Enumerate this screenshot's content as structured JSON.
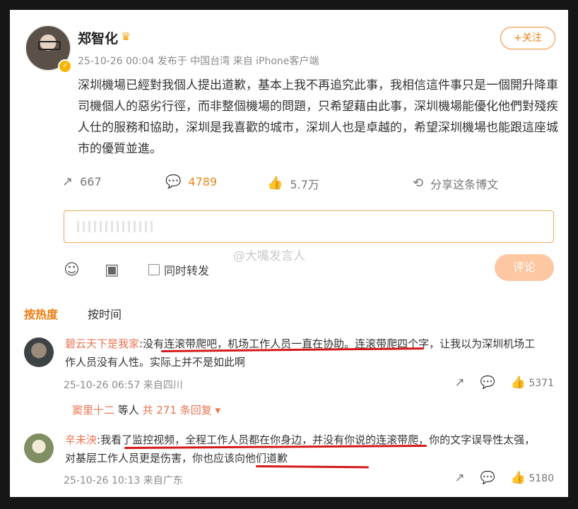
{
  "post": {
    "author": "郑智化",
    "crown_icon": "crown-icon",
    "meta": "25-10-26 00:04 发布于 中国台湾 来自 iPhone客户端",
    "follow_label": "+关注",
    "content": "深圳機場已經對我個人提出道歉，基本上我不再追究此事，我相信這件事只是一個開升降車司機個人的惡劣行徑，而非整個機場的問題，只希望藉由此事，深圳機場能優化他們對殘疾人仕的服務和協助，深圳是我喜歡的城市，深圳人也是卓越的，希望深圳機場也能跟這座城市的優質並進。",
    "repost_count": "667",
    "comment_count": "4789",
    "like_count": "5.7万",
    "share_label": "分享这条博文"
  },
  "composer": {
    "watermark": "@大嘴发言人",
    "checkbox_label": "同时转发",
    "submit_label": "评论"
  },
  "tabs": {
    "hot": "按热度",
    "time": "按时间"
  },
  "comments": [
    {
      "user": "碧云天下是我家",
      "text": ":没有连滚带爬吧，机场工作人员一直在协助。连滚带爬四个字，让我以为深圳机场工作人员没有人性。实际上并不是如此啊",
      "meta": "25-10-26 06:57 来自四川",
      "likes": "5371"
    },
    {
      "user": "辛未泱",
      "text": ":我看了监控视频，全程工作人员都在你身边，并没有你说的连滚带爬，你的文字误导性太强，对基层工作人员更是伤害，你也应该向他们道歉",
      "meta": "25-10-26 10:13 来自广东",
      "likes": "5180"
    }
  ],
  "reply_summary": {
    "user": "窦里十二",
    "middle": " 等人 ",
    "more": "共 271 条回复 ▾"
  }
}
